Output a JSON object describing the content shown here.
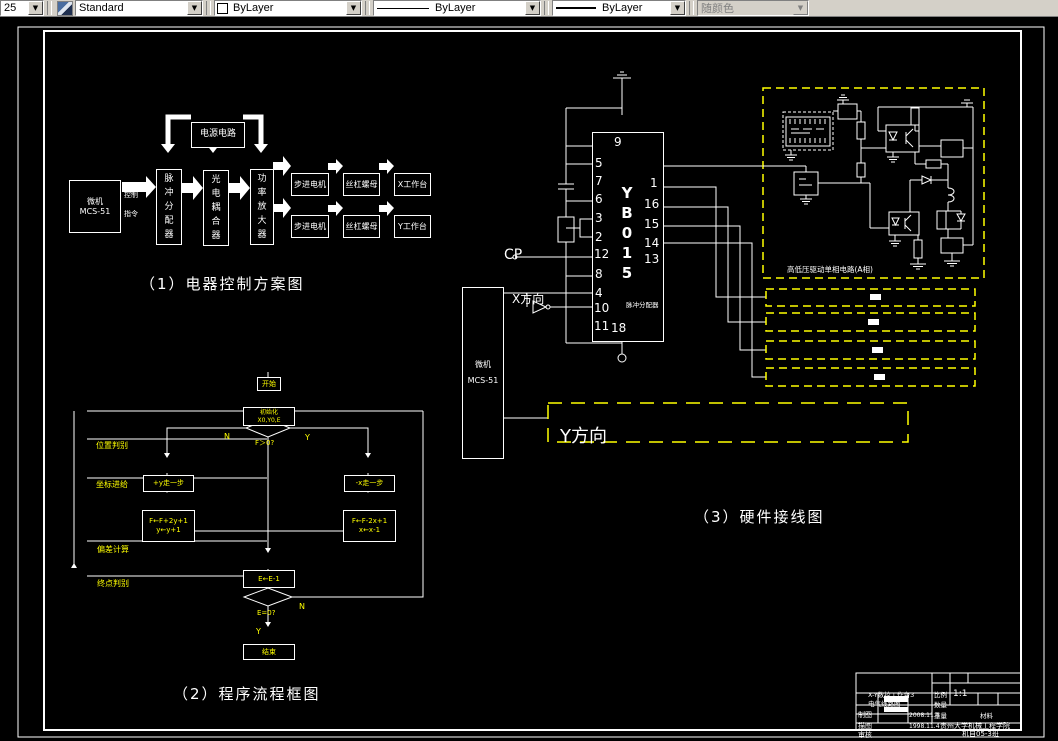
{
  "colors": {
    "line_white": "#ffffff",
    "accent_yellow": "#ffff00",
    "toolbar_bg": "#d4d0c8",
    "canvas_bg": "#000000"
  },
  "toolbar": {
    "size_combo": "25",
    "style_combo": "Standard",
    "color_combo": "ByLayer",
    "linetype_combo": "ByLayer",
    "lineweight_combo": "ByLayer",
    "plotstyle_combo": "随颜色",
    "dropdown_glyph": "▼"
  },
  "d1": {
    "caption": "（1）电器控制方案图",
    "power_box": "电源电路",
    "mcu_line1": "微机",
    "mcu_line2": "MCS-51",
    "arrow_top": "控制",
    "arrow_bottom": "指令",
    "pulse": "脉冲分配器",
    "opto": "光电耦合器",
    "amp": "功率放大器",
    "stepper1": "步进电机",
    "stepper2": "步进电机",
    "screw1": "丝杠螺母",
    "screw2": "丝杠螺母",
    "table_x": "X工作台",
    "table_y": "Y工作台"
  },
  "d2": {
    "caption": "（2）程序流程框图",
    "start": "开始",
    "init1": "初始化",
    "init2": "X0,Y0,E",
    "dec1": "F＞0?",
    "n1": "N",
    "y1": "Y",
    "stepL": "+y走一步",
    "stepR": "-x走一步",
    "calcL1": "F←F+2y+1",
    "calcL2": "y←y+1",
    "calcR1": "F←F-2x+1",
    "calcR2": "x←x-1",
    "ebox": "E←E-1",
    "dec2": "E=0?",
    "n2": "N",
    "y2": "Y",
    "end": "结束",
    "lane1": "位置判别",
    "lane2": "坐标进给",
    "lane3": "偏差计算",
    "lane4": "终点判别"
  },
  "d3": {
    "caption": "（3）硬件接线图",
    "cp": "CP",
    "x_dir": "X方向",
    "y_dir": "Y方向",
    "mcu_line1": "微机",
    "mcu_line2": "MCS-51",
    "chip_name": "YB015",
    "chip_sub": "脉冲分配器",
    "pin_top": "9",
    "pin_bottom": "18",
    "pins_left": [
      "5",
      "7",
      "6",
      "3",
      "2",
      "12",
      "8",
      "4",
      "10",
      "11"
    ],
    "pins_right": [
      "1",
      "16",
      "15",
      "14",
      "13"
    ],
    "phase_caption": "高低压驱动单相电路(A相)"
  },
  "tb": {
    "title1": "X-Y数控工作台3",
    "title2": "电气线路图",
    "scale_label": "比例",
    "scale_value": "1:1",
    "qty_label": "数量",
    "weight_label": "重量",
    "material_label": "材料",
    "row1_label": "制图",
    "row1_date": "2008.11.4",
    "row2_label": "描图",
    "row2_date": "1998.11.4",
    "row3_label": "审核",
    "org1": "贵州大学机械工程学院",
    "org2": "机自05-3班"
  }
}
